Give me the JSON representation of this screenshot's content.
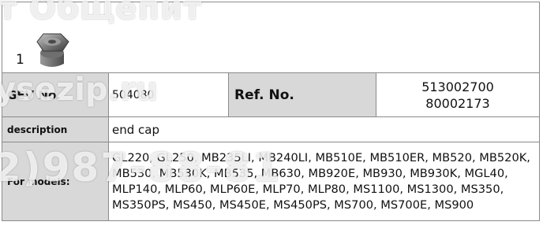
{
  "image_number": "1",
  "gev_label": "GEV No.",
  "gev_value": "504080",
  "ref_label": "Ref. No.",
  "ref_values": [
    "513002700",
    "80002173"
  ],
  "description_label": "description",
  "description_value": "end cap",
  "models_label": "For models:",
  "models_value": "GL220, GL250, MB235LI, MB240LI, MB510E, MB510ER, MB520, MB520K, MB530, MB530K, MB535, MB630, MB920E, MB930, MB930K, MGL40, MLP140, MLP60, MLP60E, MLP70, MLP80, MS1100, MS1300, MS350, MS350PS, MS450, MS450E, MS450PS, MS700, MS700E, MS900",
  "watermark_lines": [
    "т Общепит",
    "ysezip.ru",
    "2)987-88-81"
  ]
}
